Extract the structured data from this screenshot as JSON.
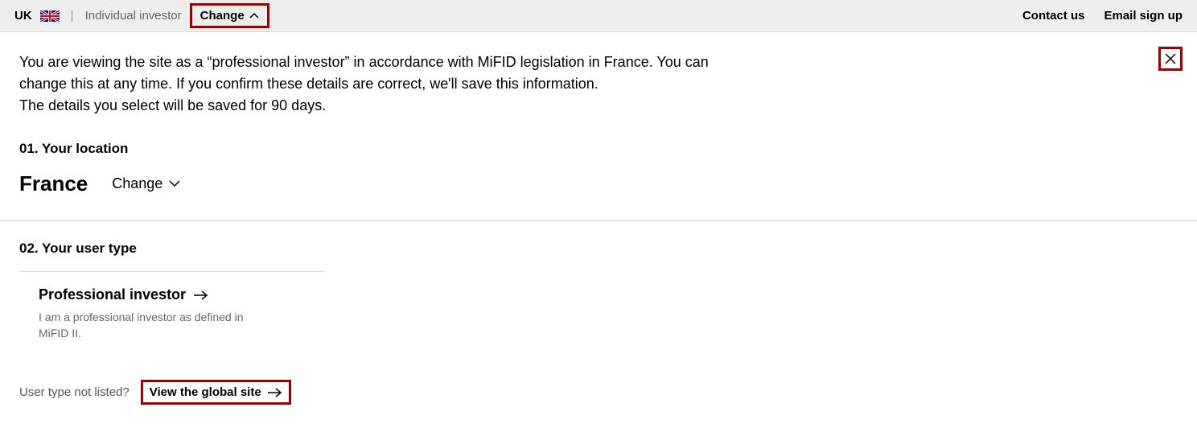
{
  "top_bar": {
    "country_code": "UK",
    "investor_type": "Individual investor",
    "change_label": "Change",
    "contact": "Contact us",
    "email_signup": "Email sign up"
  },
  "panel": {
    "intro_line1": "You are viewing the site as a “professional investor” in accordance with MiFID legislation in France. You can change this at any time. If you confirm these details are correct, we'll save this information.",
    "intro_line2": "The details you select will be saved for 90 days.",
    "section1_title": "01. Your location",
    "location": "France",
    "change_location_label": "Change",
    "section2_title": "02. Your user type",
    "option": {
      "title": "Professional investor",
      "desc": "I am a professional investor as defined in MiFID II."
    },
    "footer_prompt": "User type not listed?",
    "global_link": "View the global site"
  }
}
